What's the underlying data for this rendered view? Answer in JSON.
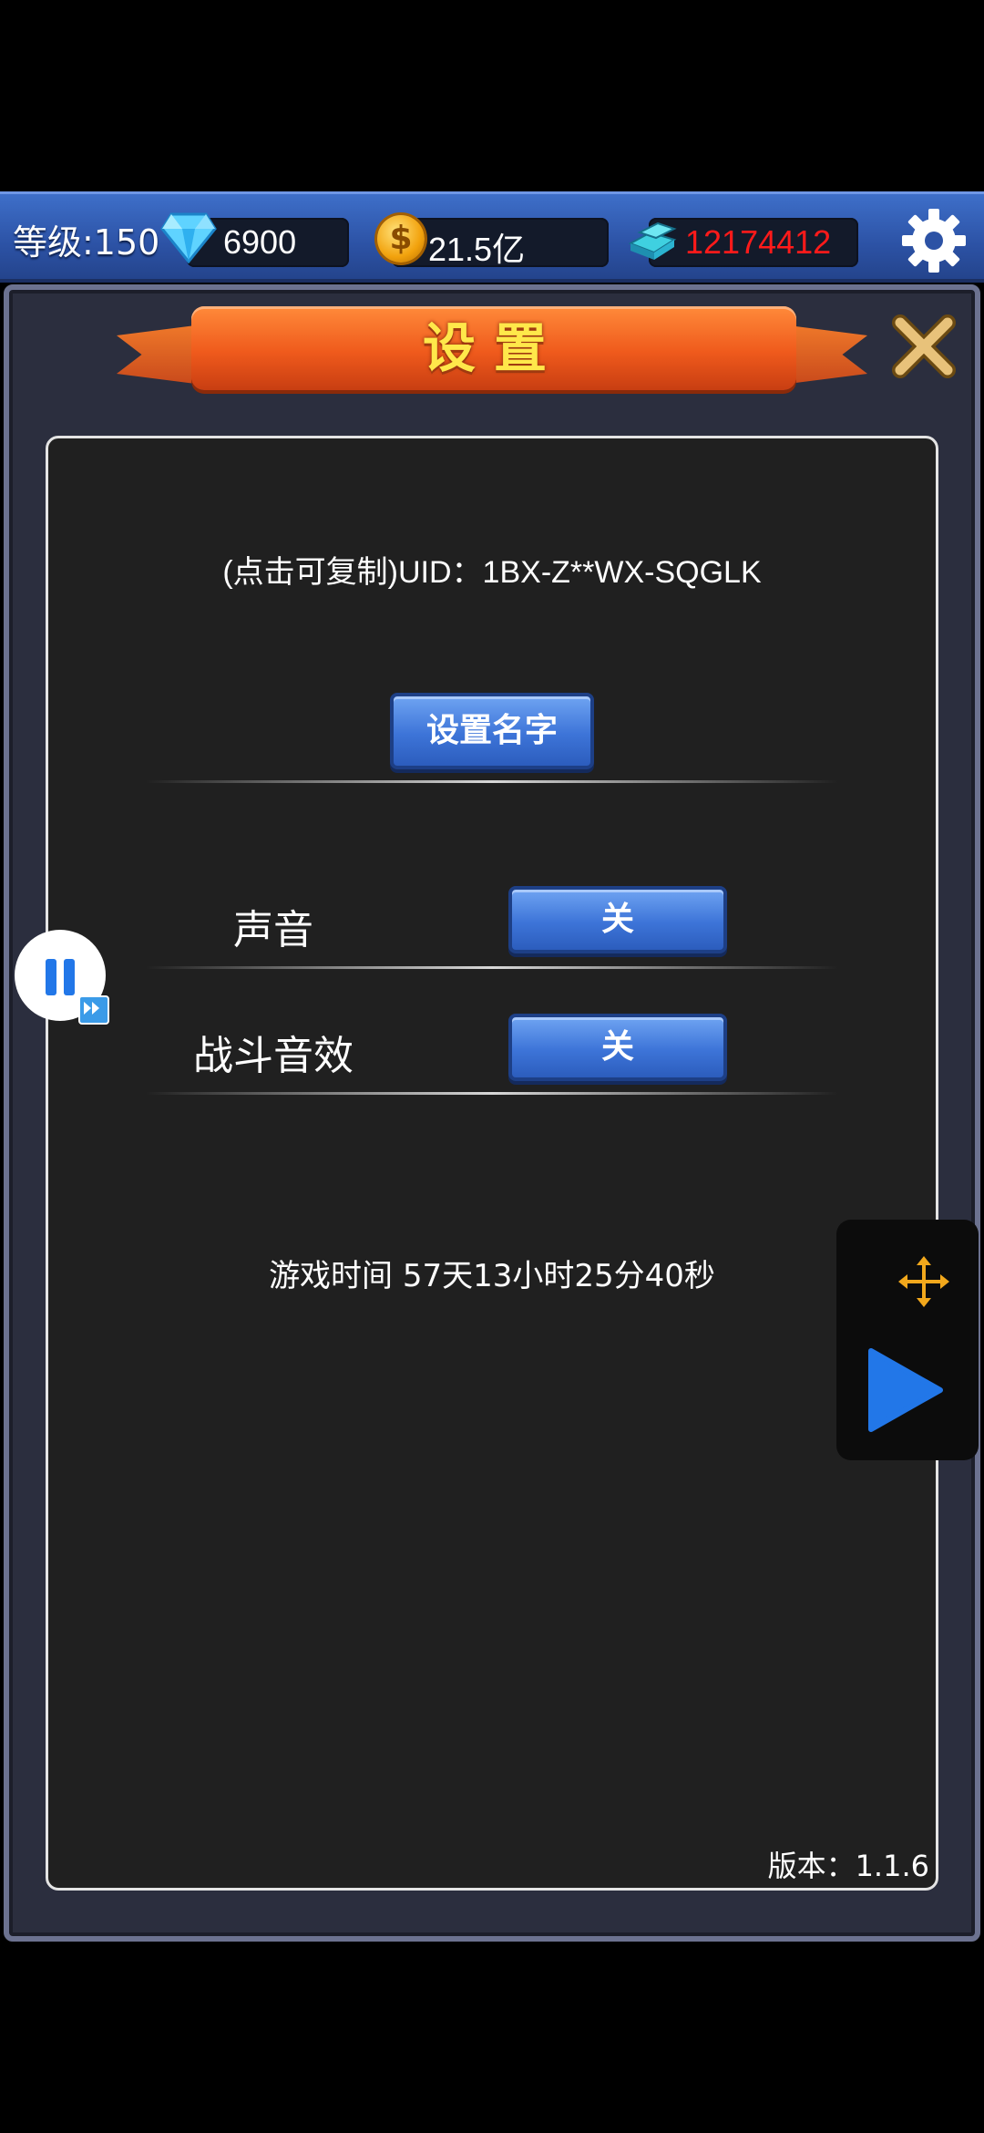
{
  "topbar": {
    "level_label": "等级:150",
    "gems": "6900",
    "gold": "21.5亿",
    "ingots": "12174412",
    "ingots_color": "#ff1a1a",
    "icons": [
      "gem-icon",
      "coin-icon",
      "ingot-icon",
      "gear-icon"
    ],
    "coin_symbol": "$"
  },
  "dialog": {
    "title": "设置",
    "close_icon": "close-x-icon",
    "uid_text": "(点击可复制)UID：1BX-Z**WX-SQGLK",
    "set_name_button": "设置名字",
    "settings": [
      {
        "label": "声音",
        "value": "关"
      },
      {
        "label": "战斗音效",
        "value": "关"
      }
    ],
    "play_time": "游戏时间 57天13小时25分40秒",
    "version": "版本：1.1.6"
  },
  "overlay": {
    "icons": [
      "pause-icon",
      "fast-forward-icon",
      "move-icon",
      "play-icon"
    ]
  },
  "colors": {
    "topbar": "#2c52a5",
    "panel_bg": "#202020",
    "banner": "#ef5a1c",
    "title_text": "#ffe84a",
    "button": "#3d74d8",
    "play_icon": "#2277e8",
    "move_icon": "#f2a81c"
  }
}
